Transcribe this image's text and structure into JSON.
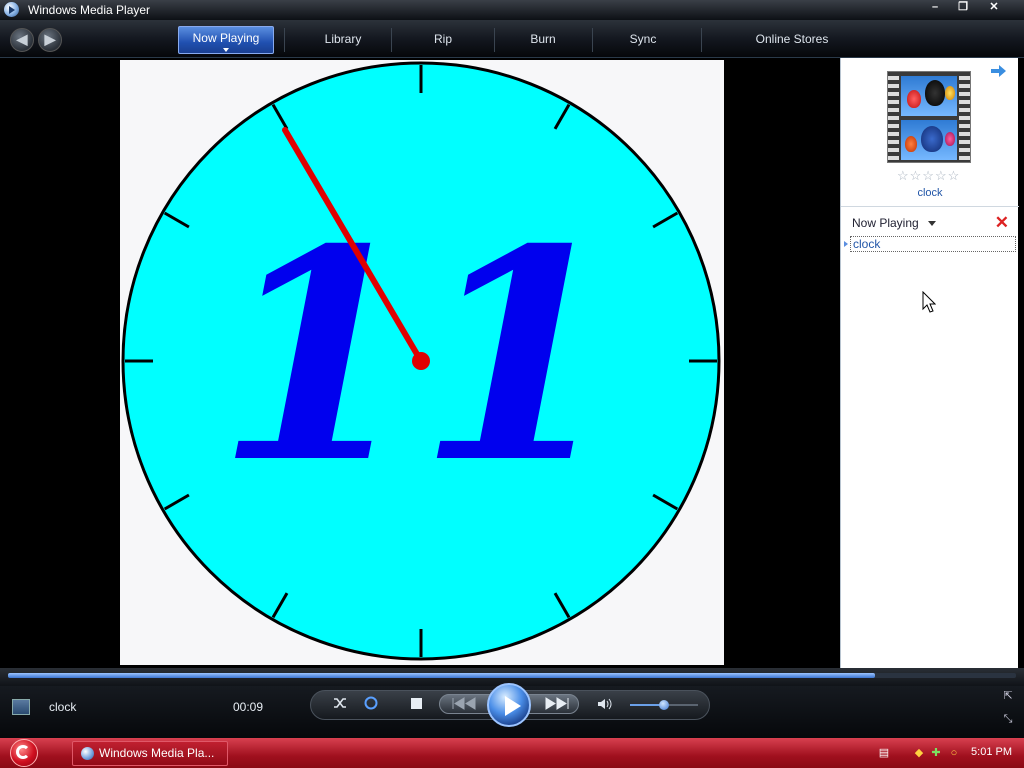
{
  "window": {
    "title": "Windows Media Player",
    "buttons": {
      "minimize": "–",
      "maximize": "❐",
      "close": "✕"
    }
  },
  "nav": {
    "back": "◀",
    "forward": "▶",
    "tabs": [
      {
        "label": "Now Playing",
        "active": true
      },
      {
        "label": "Library"
      },
      {
        "label": "Rip"
      },
      {
        "label": "Burn"
      },
      {
        "label": "Sync"
      },
      {
        "label": "Online Stores"
      }
    ]
  },
  "video": {
    "clock_face_color": "#00ffff",
    "digits_color": "#0000ee",
    "hand_color": "#e00000",
    "digits": "11"
  },
  "pane": {
    "thumbnail_title": "clock",
    "rating_stars": "☆☆☆☆☆",
    "rating": 0,
    "list_title": "Now Playing",
    "list_close": "✕",
    "playlist": [
      {
        "title": "clock"
      }
    ]
  },
  "player": {
    "current_title": "clock",
    "elapsed": "00:09",
    "seek_progress": 0.86,
    "volume": 0.5,
    "icons": {
      "shuffle": "shuffle-icon",
      "repeat": "repeat-icon",
      "stop": "stop-icon",
      "previous": "previous-icon",
      "play": "play-icon",
      "next": "next-icon",
      "mute": "speaker-icon"
    }
  },
  "taskbar": {
    "task_label": "Windows Media Pla...",
    "clock": "5:01 PM",
    "accent": "#b8121f"
  }
}
